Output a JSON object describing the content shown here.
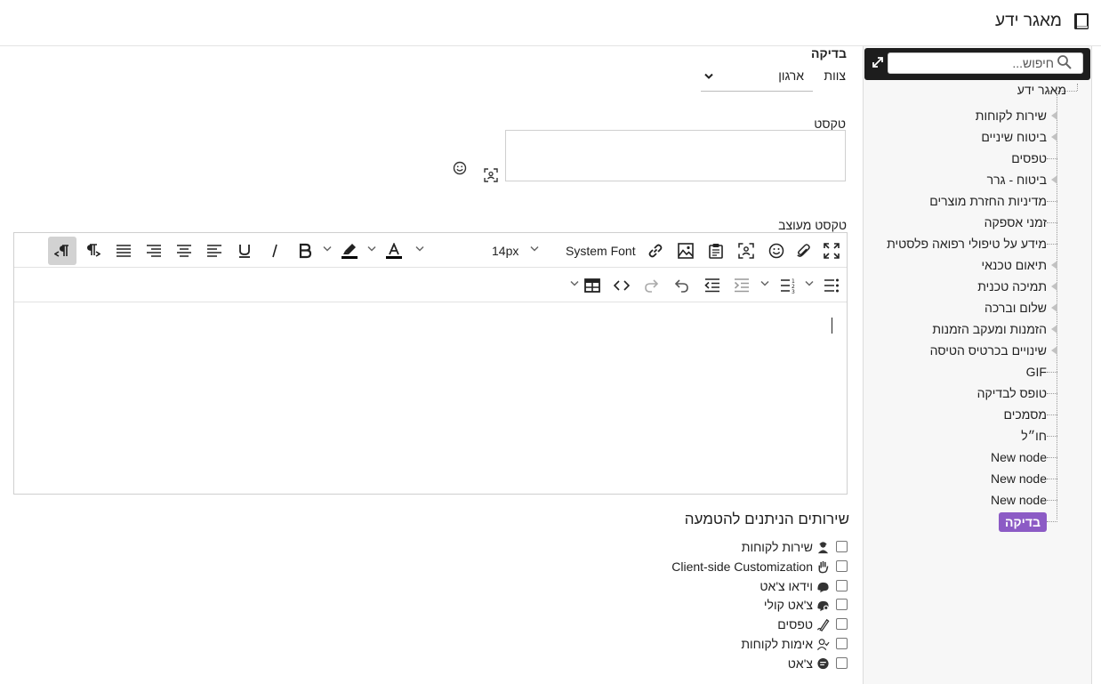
{
  "header": {
    "title": "מאגר ידע",
    "icon": "book-icon"
  },
  "sidebar": {
    "search": {
      "placeholder": "חיפוש...",
      "value": ""
    },
    "root": "מאגר ידע",
    "items": [
      {
        "label": "שירות לקוחות",
        "expandable": true
      },
      {
        "label": "ביטוח שיניים",
        "expandable": true
      },
      {
        "label": "טפסים",
        "expandable": false
      },
      {
        "label": "ביטוח - גרר",
        "expandable": true
      },
      {
        "label": "מדיניות החזרת מוצרים",
        "expandable": false
      },
      {
        "label": "זמני אספקה",
        "expandable": false
      },
      {
        "label": "מידע על טיפולי רפואה פלסטית",
        "expandable": false
      },
      {
        "label": "תיאום טכנאי",
        "expandable": true
      },
      {
        "label": "תמיכה טכנית",
        "expandable": true
      },
      {
        "label": "שלום וברכה",
        "expandable": true
      },
      {
        "label": "הזמנות ומעקב הזמנות",
        "expandable": true
      },
      {
        "label": "שינויים בכרטיס הטיסה",
        "expandable": true
      },
      {
        "label": "GIF",
        "expandable": false
      },
      {
        "label": "טופס לבדיקה",
        "expandable": false
      },
      {
        "label": "מסמכים",
        "expandable": false
      },
      {
        "label": "חו״ל",
        "expandable": false
      },
      {
        "label": "New node",
        "expandable": false
      },
      {
        "label": "New node",
        "expandable": false
      },
      {
        "label": "New node",
        "expandable": false
      },
      {
        "label": "בדיקה",
        "expandable": false,
        "selected": true
      }
    ],
    "selected_color": "#8c5bc5"
  },
  "main": {
    "section_title": "בדיקה",
    "team_label": "צוות",
    "org_select_value": "ארגון",
    "text_label": "טקסט",
    "text_value": "",
    "rich_text_label": "טקסט מעוצב",
    "toolbar": {
      "font_family": "System Font",
      "font_size": "14px",
      "text_color": "#000000",
      "highlight_color": "#000000"
    },
    "services_title": "שירותים הניתנים להטמעה",
    "services": [
      {
        "label": "שירות לקוחות",
        "icon": "support-agent-icon",
        "checked": false
      },
      {
        "label": "Client-side Customization",
        "icon": "hand-icon",
        "checked": false
      },
      {
        "label": "וידאו צ'אט",
        "icon": "video-chat-icon",
        "checked": false
      },
      {
        "label": "צ'אט קולי",
        "icon": "voice-chat-icon",
        "checked": false
      },
      {
        "label": "טפסים",
        "icon": "form-pen-icon",
        "checked": false
      },
      {
        "label": "אימות לקוחות",
        "icon": "user-check-icon",
        "checked": false
      },
      {
        "label": "צ'אט",
        "icon": "chat-bubble-icon",
        "checked": false
      }
    ]
  }
}
